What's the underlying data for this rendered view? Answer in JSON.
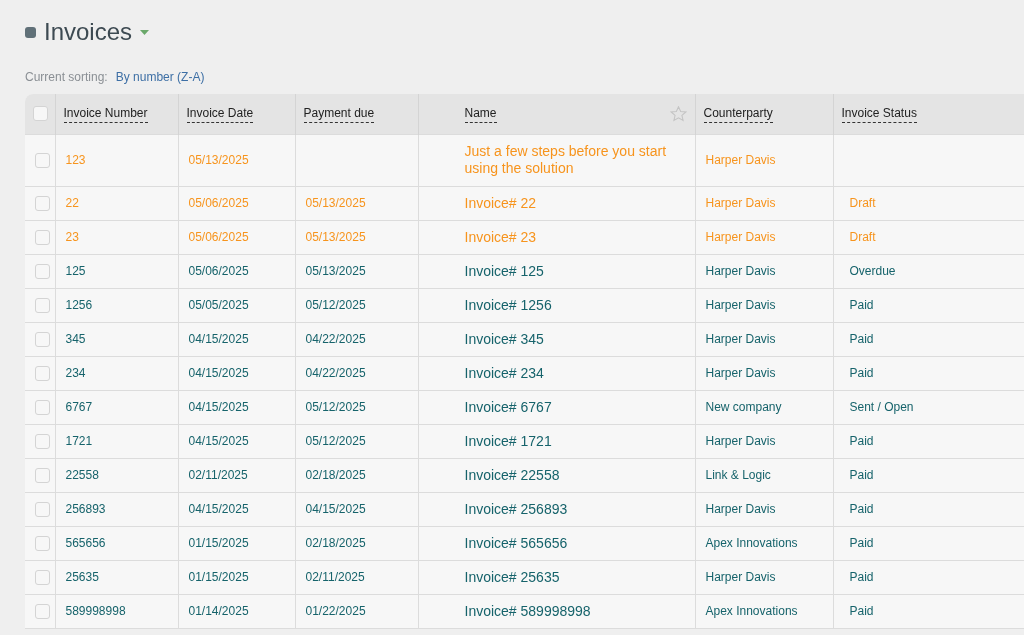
{
  "page": {
    "title": "Invoices",
    "sorting_label": "Current sorting:",
    "sorting_value": "By number (Z-A)"
  },
  "table": {
    "select_all_checked": false,
    "columns": [
      "Invoice Number",
      "Invoice Date",
      "Payment due",
      "Name",
      "Counterparty",
      "Invoice Status"
    ],
    "rows": [
      {
        "checked": false,
        "color": "#f7941d",
        "cells": [
          "123",
          "05/13/2025",
          "",
          "Just a few steps before you start using the solution",
          "Harper Davis",
          ""
        ]
      },
      {
        "checked": false,
        "color": "#f7941d",
        "cells": [
          "22",
          "05/06/2025",
          "05/13/2025",
          "Invoice# 22",
          "Harper Davis",
          "Draft"
        ]
      },
      {
        "checked": false,
        "color": "#f7941d",
        "cells": [
          "23",
          "05/06/2025",
          "05/13/2025",
          "Invoice# 23",
          "Harper Davis",
          "Draft"
        ]
      },
      {
        "checked": false,
        "color": "#16636b",
        "cells": [
          "125",
          "05/06/2025",
          "05/13/2025",
          "Invoice# 125",
          "Harper Davis",
          "Overdue"
        ]
      },
      {
        "checked": false,
        "color": "#16636b",
        "cells": [
          "1256",
          "05/05/2025",
          "05/12/2025",
          "Invoice# 1256",
          "Harper Davis",
          "Paid"
        ]
      },
      {
        "checked": false,
        "color": "#16636b",
        "cells": [
          "345",
          "04/15/2025",
          "04/22/2025",
          "Invoice# 345",
          "Harper Davis",
          "Paid"
        ]
      },
      {
        "checked": false,
        "color": "#16636b",
        "cells": [
          "234",
          "04/15/2025",
          "04/22/2025",
          "Invoice# 234",
          "Harper Davis",
          "Paid"
        ]
      },
      {
        "checked": false,
        "color": "#16636b",
        "cells": [
          "6767",
          "04/15/2025",
          "05/12/2025",
          "Invoice# 6767",
          "New company",
          "Sent / Open"
        ]
      },
      {
        "checked": false,
        "color": "#16636b",
        "cells": [
          "1721",
          "04/15/2025",
          "05/12/2025",
          "Invoice# 1721",
          "Harper Davis",
          "Paid"
        ]
      },
      {
        "checked": false,
        "color": "#16636b",
        "cells": [
          "22558",
          "02/11/2025",
          "02/18/2025",
          "Invoice# 22558",
          "Link & Logic",
          "Paid"
        ]
      },
      {
        "checked": false,
        "color": "#16636b",
        "cells": [
          "256893",
          "04/15/2025",
          "04/15/2025",
          "Invoice# 256893",
          "Harper Davis",
          "Paid"
        ]
      },
      {
        "checked": false,
        "color": "#16636b",
        "cells": [
          "565656",
          "01/15/2025",
          "02/18/2025",
          "Invoice# 565656",
          "Apex Innovations",
          "Paid"
        ]
      },
      {
        "checked": false,
        "color": "#16636b",
        "cells": [
          "25635",
          "01/15/2025",
          "02/11/2025",
          "Invoice# 25635",
          "Harper Davis",
          "Paid"
        ]
      },
      {
        "checked": false,
        "color": "#16636b",
        "cells": [
          "589998998",
          "01/14/2025",
          "01/22/2025",
          "Invoice# 589998998",
          "Apex Innovations",
          "Paid"
        ]
      }
    ]
  }
}
